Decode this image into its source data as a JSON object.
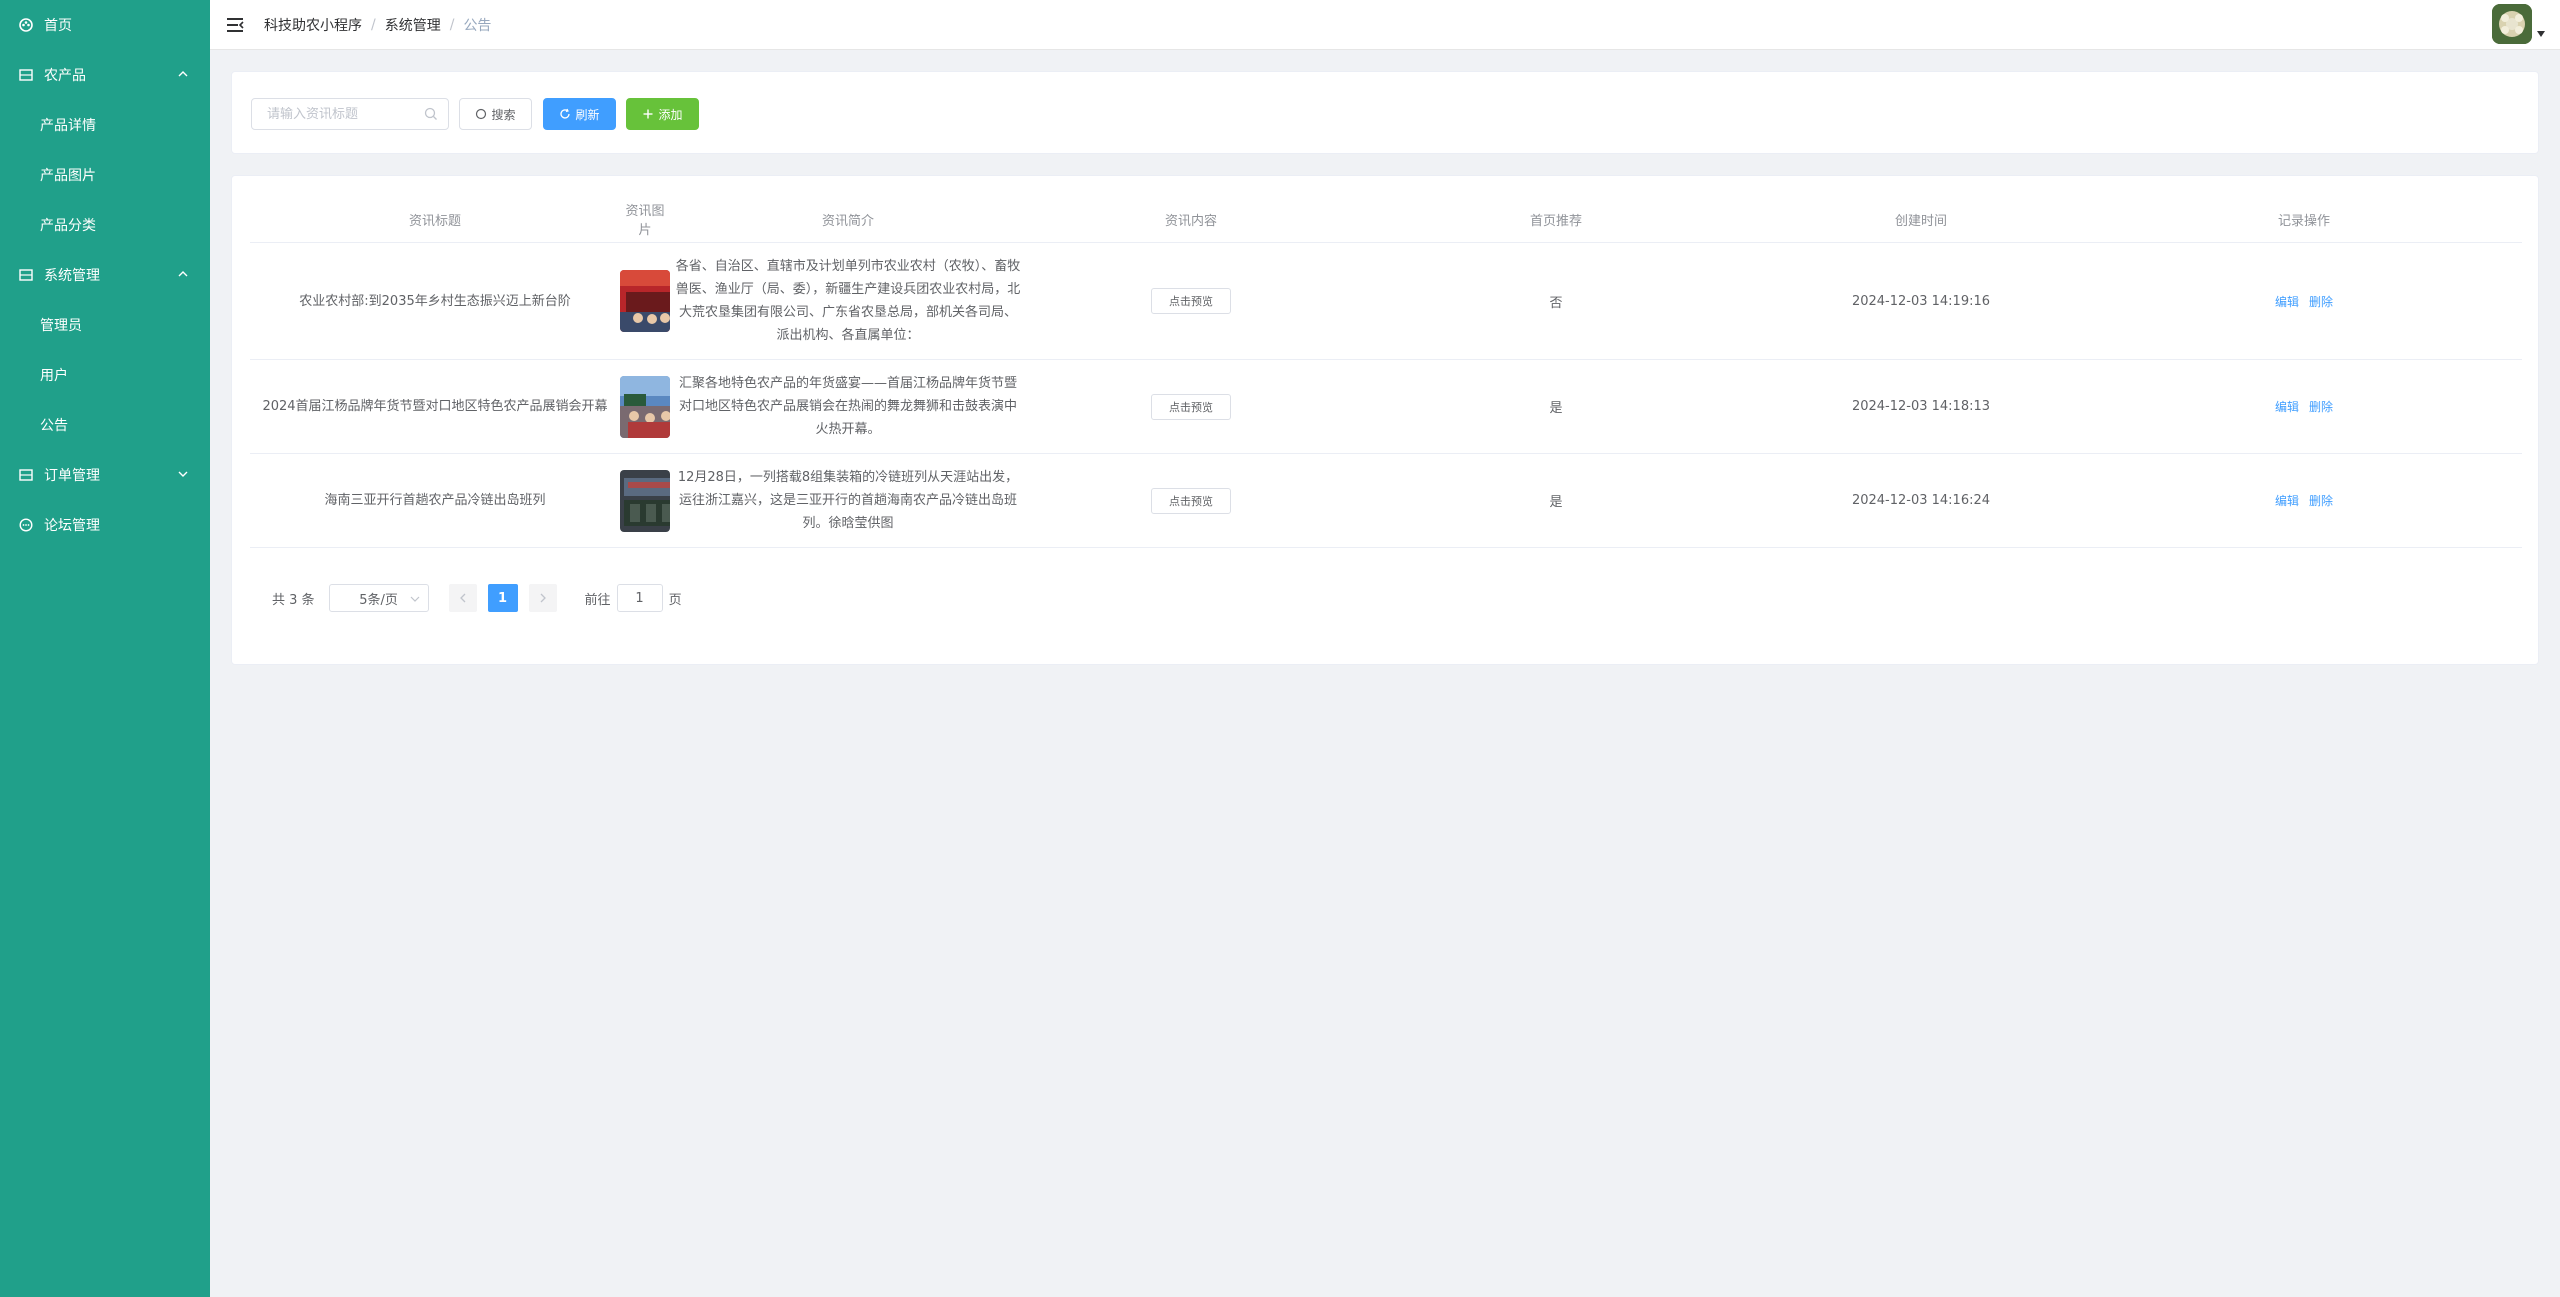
{
  "sidebar": {
    "items": [
      {
        "label": "首页",
        "icon": "dashboard-icon"
      },
      {
        "label": "农产品",
        "icon": "grid-icon",
        "expanded": true
      },
      {
        "label": "产品详情"
      },
      {
        "label": "产品图片"
      },
      {
        "label": "产品分类"
      },
      {
        "label": "系统管理",
        "icon": "grid-icon",
        "expanded": true
      },
      {
        "label": "管理员"
      },
      {
        "label": "用户"
      },
      {
        "label": "公告"
      },
      {
        "label": "订单管理",
        "icon": "grid-icon",
        "expanded": false
      },
      {
        "label": "论坛管理",
        "icon": "chat-icon"
      }
    ]
  },
  "header": {
    "breadcrumb": [
      "科技助农小程序",
      "系统管理",
      "公告"
    ],
    "separator": "/"
  },
  "toolbar": {
    "search_placeholder": "请输入资讯标题",
    "search_label": "搜索",
    "refresh_label": "刷新",
    "add_label": "添加"
  },
  "table": {
    "columns": [
      "资讯标题",
      "资讯图片",
      "资讯简介",
      "资讯内容",
      "首页推荐",
      "创建时间",
      "记录操作"
    ],
    "rows": [
      {
        "title": "农业农村部:到2035年乡村生态振兴迈上新台阶",
        "intro": "各省、自治区、直辖市及计划单列市农业农村（农牧）、畜牧兽医、渔业厅（局、委），新疆生产建设兵团农业农村局，北大荒农垦集团有限公司、广东省农垦总局，部机关各司局、派出机构、各直属单位：",
        "preview": "点击预览",
        "recommend": "否",
        "created": "2024-12-03 14:19:16",
        "edit": "编辑",
        "delete": "删除"
      },
      {
        "title": "2024首届江杨品牌年货节暨对口地区特色农产品展销会开幕",
        "intro": "汇聚各地特色农产品的年货盛宴——首届江杨品牌年货节暨对口地区特色农产品展销会在热闹的舞龙舞狮和击鼓表演中火热开幕。",
        "preview": "点击预览",
        "recommend": "是",
        "created": "2024-12-03 14:18:13",
        "edit": "编辑",
        "delete": "删除"
      },
      {
        "title": "海南三亚开行首趟农产品冷链出岛班列",
        "intro": "12月28日，一列搭载8组集装箱的冷链班列从天涯站出发，运往浙江嘉兴，这是三亚开行的首趟海南农产品冷链出岛班列。徐晗莹供图",
        "preview": "点击预览",
        "recommend": "是",
        "created": "2024-12-03 14:16:24",
        "edit": "编辑",
        "delete": "删除"
      }
    ]
  },
  "pagination": {
    "total_label": "共 3 条",
    "page_size": "5条/页",
    "current_page": "1",
    "goto_prefix": "前往",
    "goto_value": "1",
    "goto_suffix": "页"
  },
  "colors": {
    "sidebar_bg": "#20a08a",
    "primary": "#409eff",
    "success": "#67c23a"
  }
}
